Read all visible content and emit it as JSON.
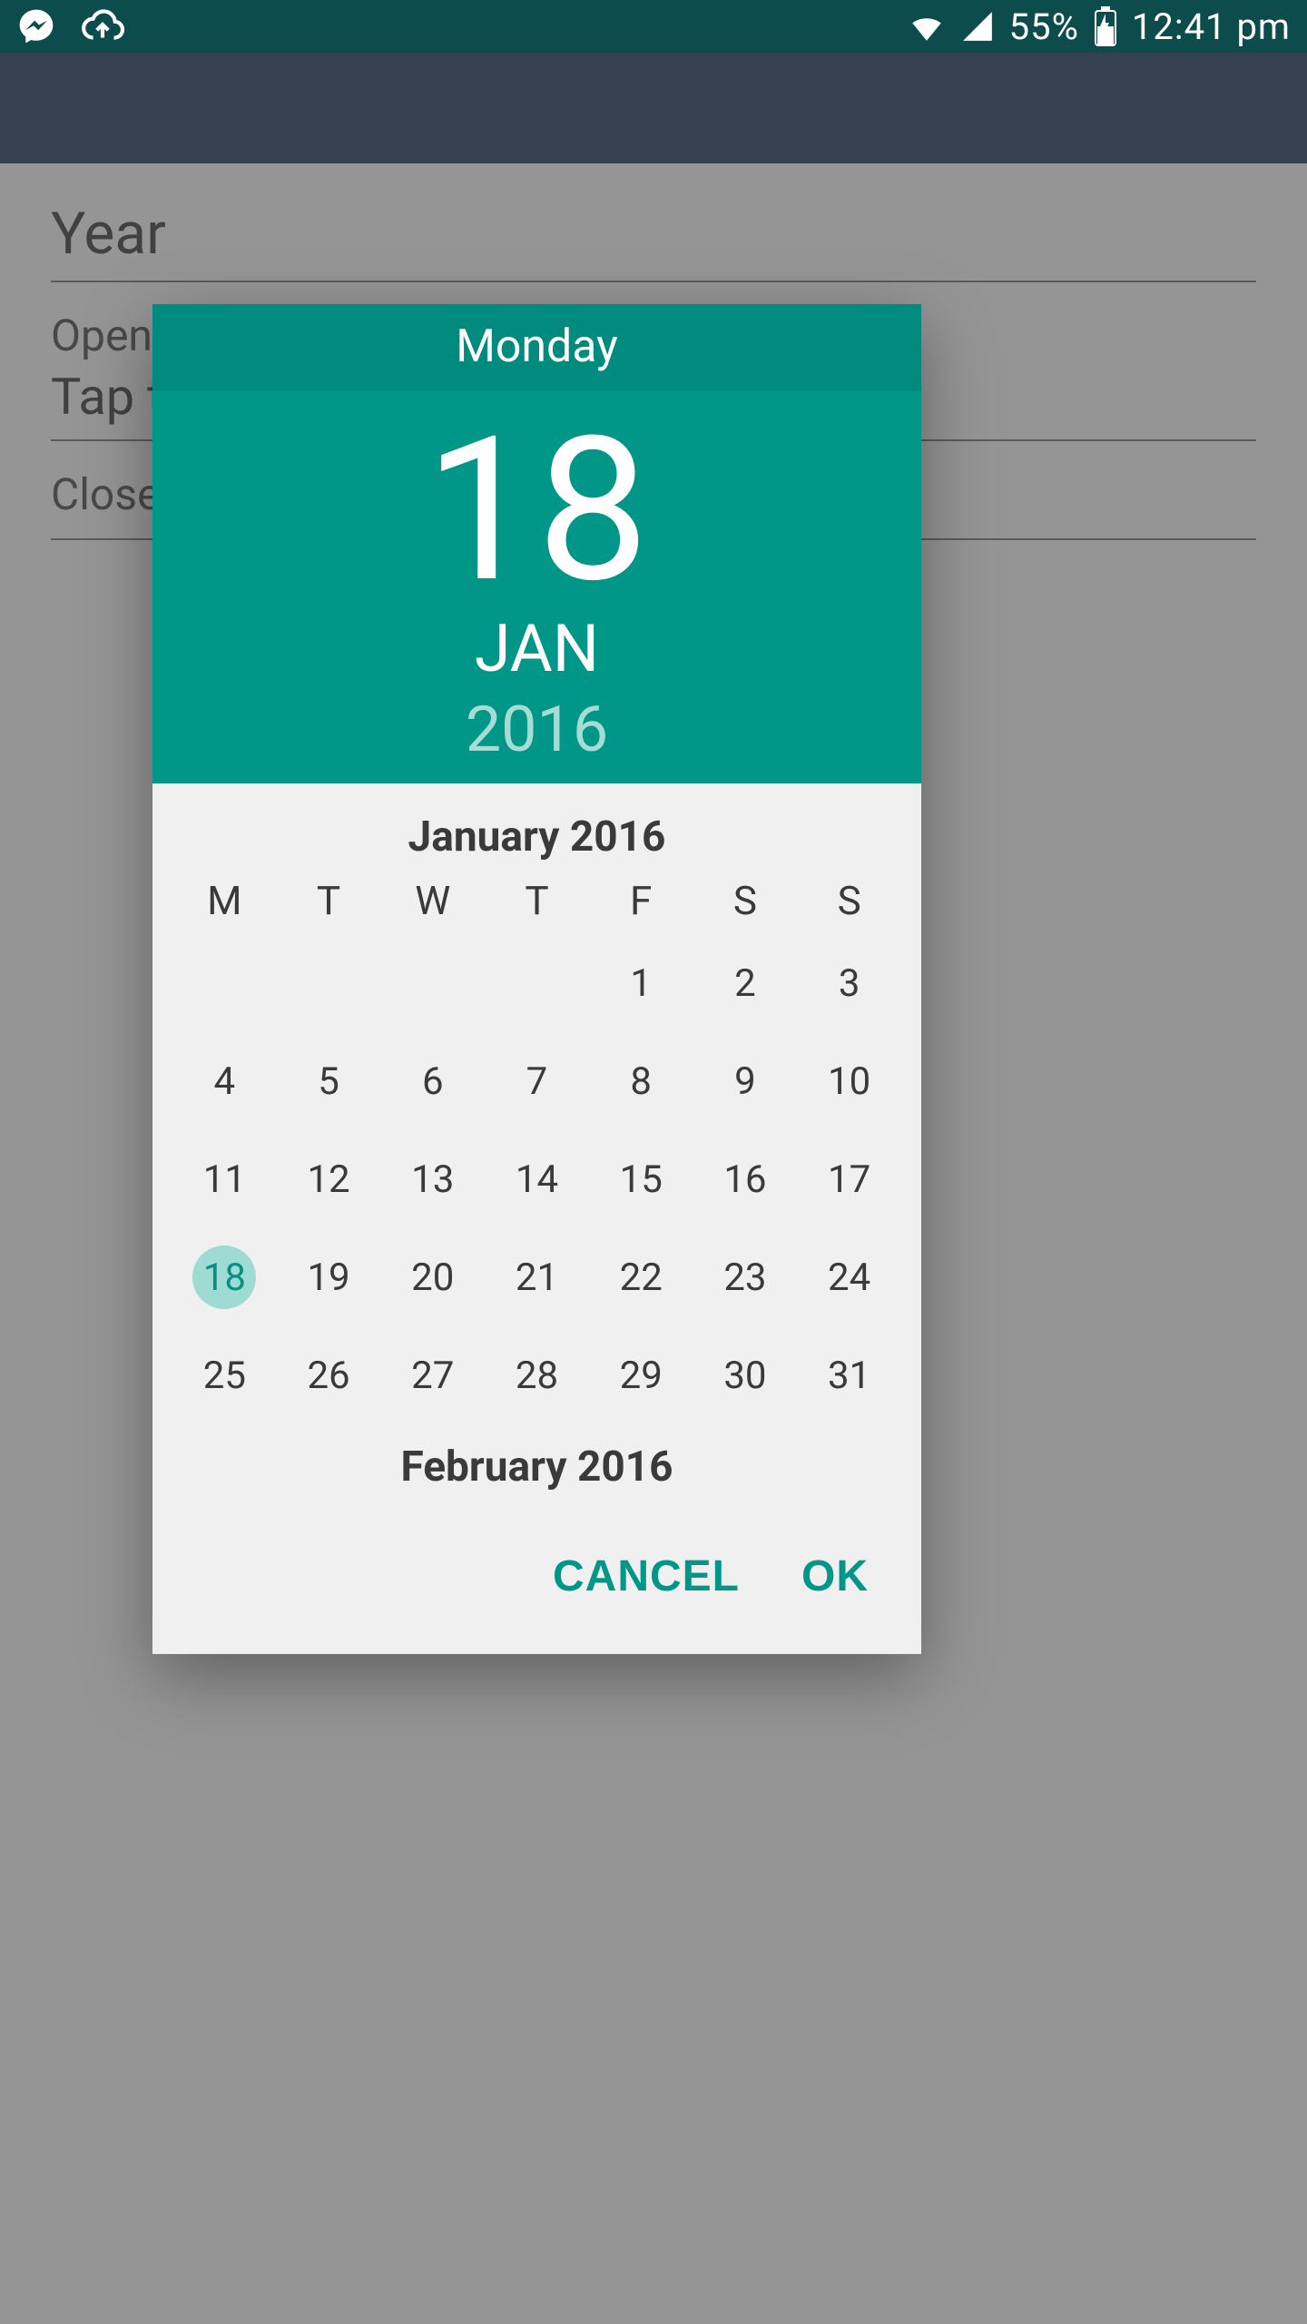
{
  "status": {
    "battery": "55%",
    "time": "12:41 pm"
  },
  "background": {
    "year_label": "Year",
    "open_label": "Open",
    "open_value": "Tap t",
    "close_label": "Close",
    "close_value": ""
  },
  "picker": {
    "weekday": "Monday",
    "day": "18",
    "month_abbrev": "JAN",
    "year": "2016",
    "month_title": "January 2016",
    "next_month_title": "February 2016",
    "dow": [
      "M",
      "T",
      "W",
      "T",
      "F",
      "S",
      "S"
    ],
    "days": [
      "",
      "",
      "",
      "",
      "1",
      "2",
      "3",
      "4",
      "5",
      "6",
      "7",
      "8",
      "9",
      "10",
      "11",
      "12",
      "13",
      "14",
      "15",
      "16",
      "17",
      "18",
      "19",
      "20",
      "21",
      "22",
      "23",
      "24",
      "25",
      "26",
      "27",
      "28",
      "29",
      "30",
      "31"
    ],
    "selected_day_index": 21,
    "cancel_label": "CANCEL",
    "ok_label": "OK",
    "accent_color": "#009688"
  }
}
